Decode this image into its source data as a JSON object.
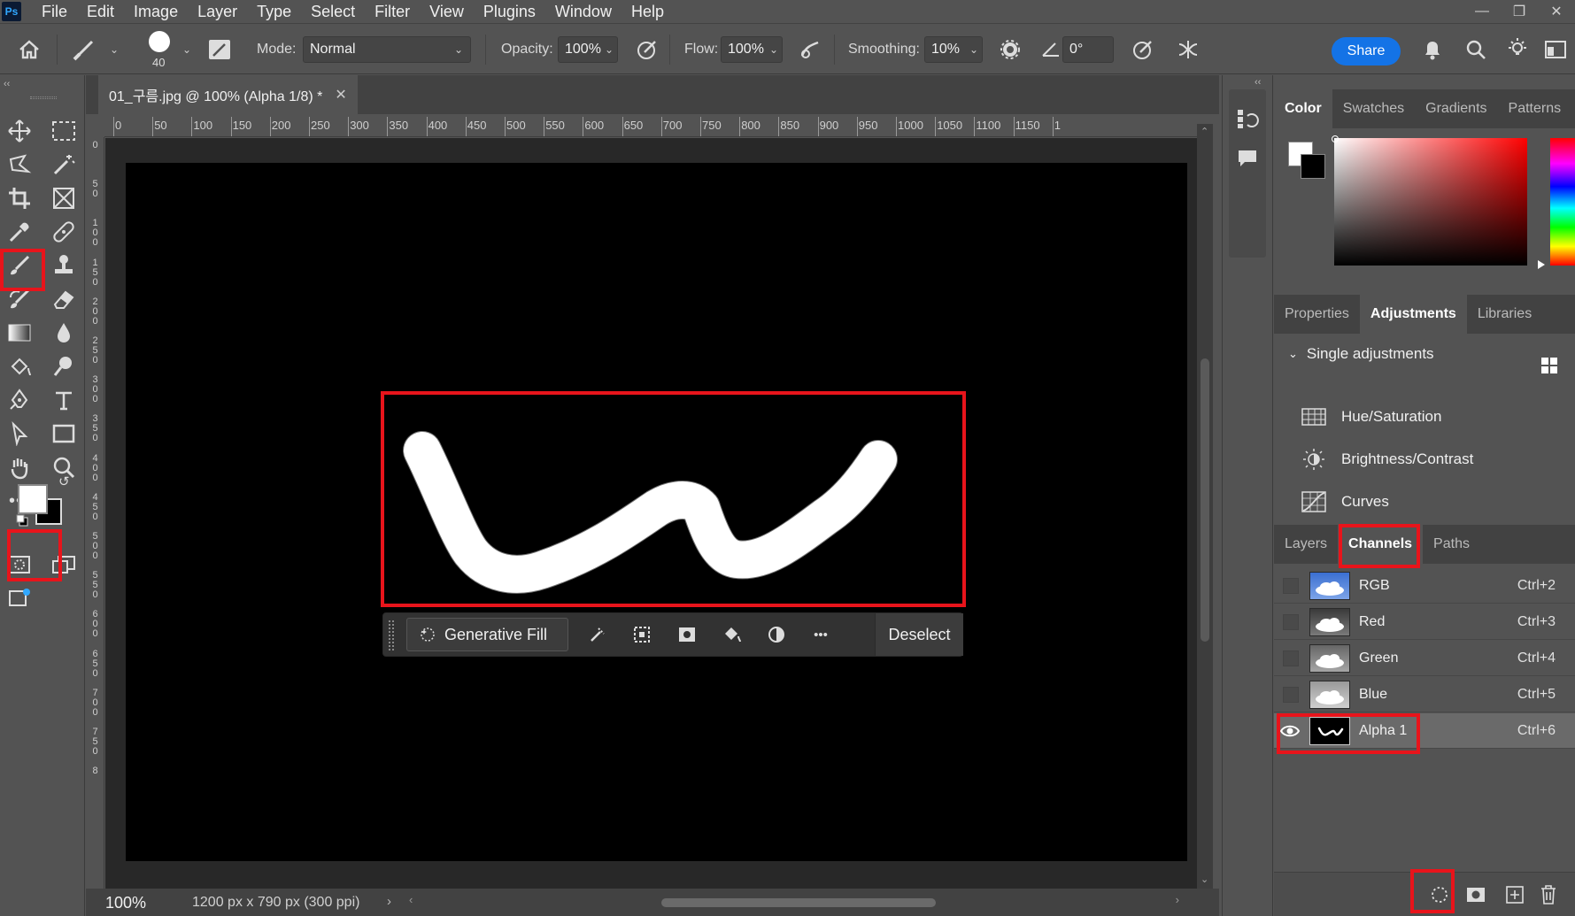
{
  "app": {
    "logo": "Ps"
  },
  "menu": [
    "File",
    "Edit",
    "Image",
    "Layer",
    "Type",
    "Select",
    "Filter",
    "View",
    "Plugins",
    "Window",
    "Help"
  ],
  "options": {
    "brush_size": "40",
    "mode_label": "Mode:",
    "mode_value": "Normal",
    "opacity_label": "Opacity:",
    "opacity_value": "100%",
    "flow_label": "Flow:",
    "flow_value": "100%",
    "smoothing_label": "Smoothing:",
    "smoothing_value": "10%",
    "angle_value": "0°",
    "share_label": "Share"
  },
  "document": {
    "tab_title": "01_구름.jpg @ 100% (Alpha 1/8) *",
    "zoom": "100%",
    "info": "1200 px x 790 px (300 ppi)"
  },
  "ruler": {
    "top": [
      "0",
      "50",
      "100",
      "150",
      "200",
      "250",
      "300",
      "350",
      "400",
      "450",
      "500",
      "550",
      "600",
      "650",
      "700",
      "750",
      "800",
      "850",
      "900",
      "950",
      "1000",
      "1050",
      "1100",
      "1150",
      "1"
    ],
    "left": [
      "0",
      "5 0",
      "1 0 0",
      "1 5 0",
      "2 0 0",
      "2 5 0",
      "3 0 0",
      "3 5 0",
      "4 0 0",
      "4 5 0",
      "5 0 0",
      "5 5 0",
      "6 0 0",
      "6 5 0",
      "7 0 0",
      "7 5 0",
      "8"
    ]
  },
  "context_bar": {
    "generative_fill": "Generative Fill",
    "deselect": "Deselect",
    "more": "•••"
  },
  "color_panel": {
    "tabs": [
      "Color",
      "Swatches",
      "Gradients",
      "Patterns"
    ],
    "foreground": "#ffffff",
    "background": "#000000"
  },
  "adjustments_panel": {
    "tabs": [
      "Properties",
      "Adjustments",
      "Libraries"
    ],
    "section": "Single adjustments",
    "items": [
      "Hue/Saturation",
      "Brightness/Contrast",
      "Curves"
    ]
  },
  "channels_panel": {
    "tabs": [
      "Layers",
      "Channels",
      "Paths"
    ],
    "channels": [
      {
        "name": "RGB",
        "shortcut": "Ctrl+2"
      },
      {
        "name": "Red",
        "shortcut": "Ctrl+3"
      },
      {
        "name": "Green",
        "shortcut": "Ctrl+4"
      },
      {
        "name": "Blue",
        "shortcut": "Ctrl+5"
      },
      {
        "name": "Alpha 1",
        "shortcut": "Ctrl+6"
      }
    ]
  },
  "colors": {
    "highlight": "#e8141b",
    "share": "#1473e6",
    "panel": "#535353"
  }
}
